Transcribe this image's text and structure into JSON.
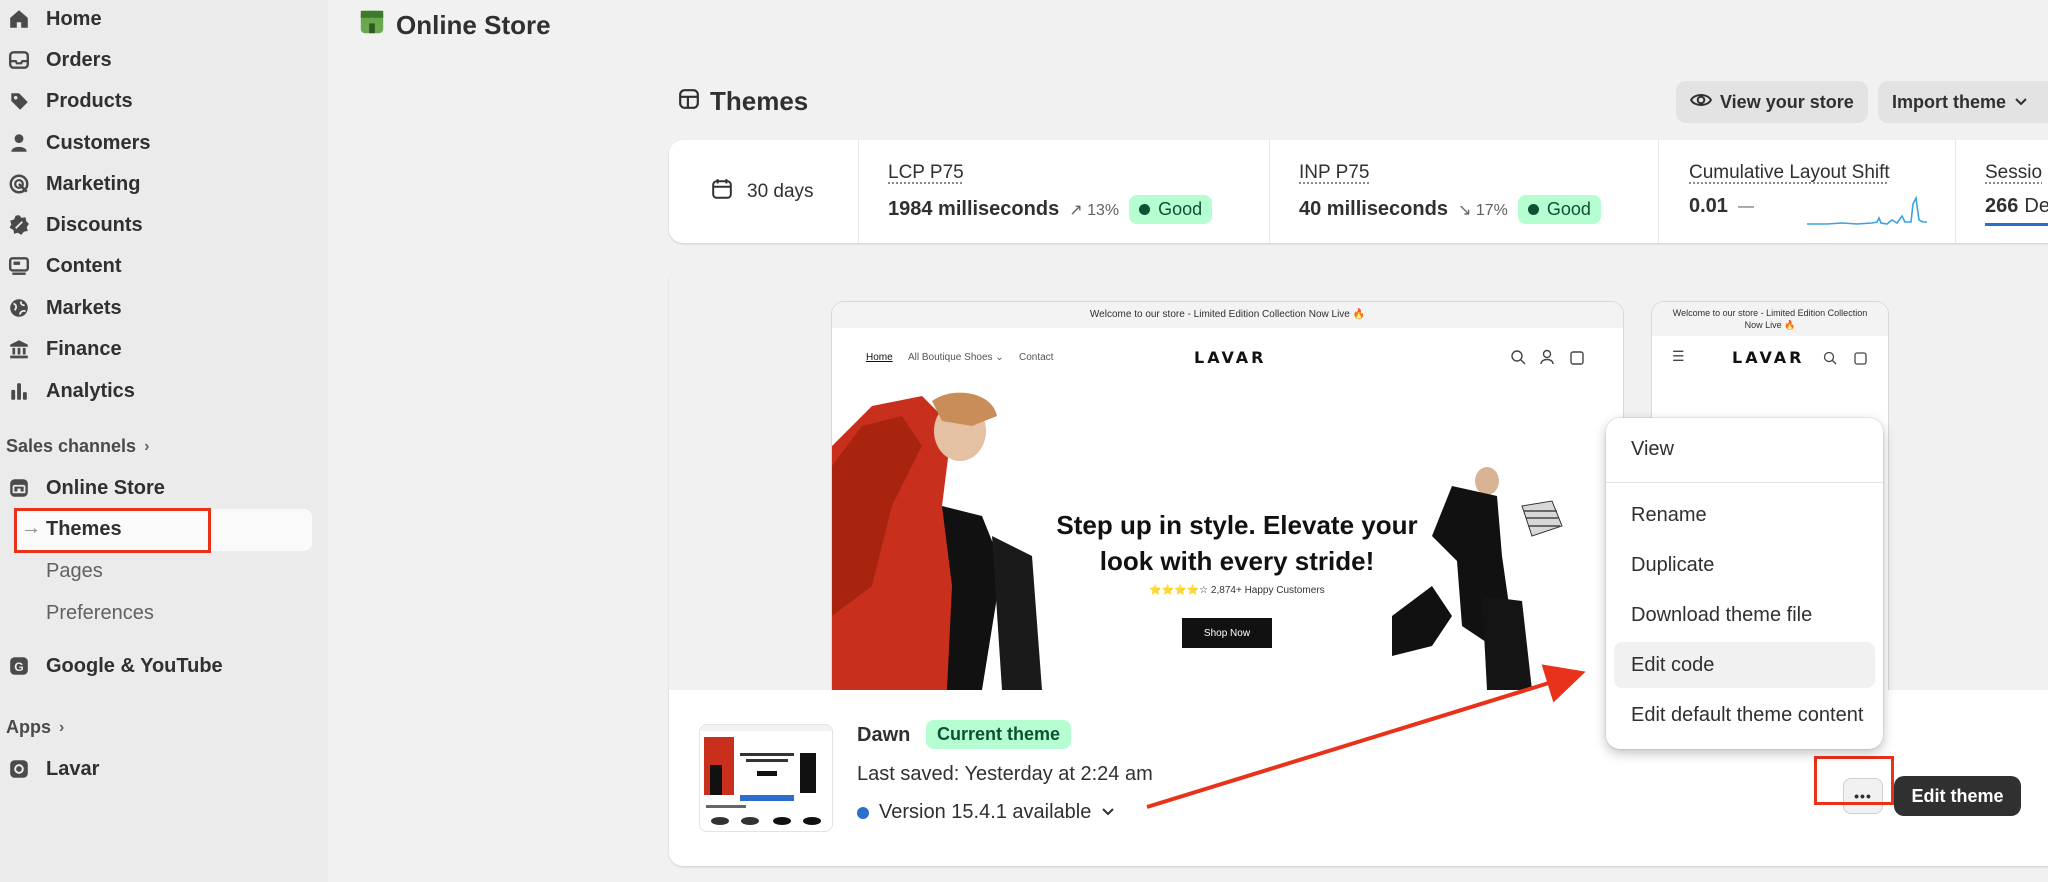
{
  "sidebar": {
    "items": [
      {
        "label": "Home",
        "icon": "home-icon"
      },
      {
        "label": "Orders",
        "icon": "orders-icon"
      },
      {
        "label": "Products",
        "icon": "tag-icon"
      },
      {
        "label": "Customers",
        "icon": "person-icon"
      },
      {
        "label": "Marketing",
        "icon": "target-icon"
      },
      {
        "label": "Discounts",
        "icon": "discount-icon"
      },
      {
        "label": "Content",
        "icon": "content-icon"
      },
      {
        "label": "Markets",
        "icon": "globe-icon"
      },
      {
        "label": "Finance",
        "icon": "bank-icon"
      },
      {
        "label": "Analytics",
        "icon": "bar-chart-icon"
      }
    ],
    "sales_channels_label": "Sales channels",
    "online_store": "Online Store",
    "sub_items": [
      "Themes",
      "Pages",
      "Preferences"
    ],
    "google": "Google & YouTube",
    "apps_label": "Apps",
    "lavar": "Lavar"
  },
  "header": {
    "title": "Online Store",
    "themes_title": "Themes",
    "view_store": "View your store",
    "import_theme": "Import theme"
  },
  "metrics": {
    "range": "30 days",
    "lcp": {
      "title": "LCP P75",
      "value": "1984 milliseconds",
      "change": "13%",
      "status": "Good"
    },
    "inp": {
      "title": "INP P75",
      "value": "40 milliseconds",
      "change": "17%",
      "status": "Good"
    },
    "cls": {
      "title": "Cumulative Layout Shift",
      "value": "0.01",
      "change": "—"
    },
    "sessions": {
      "title": "Sessio",
      "value": "266",
      "suffix": "De"
    }
  },
  "preview": {
    "announcement": "Welcome to our store - Limited Edition Collection Now Live 🔥",
    "mobile_announcement_1": "Welcome to our store - Limited Edition Collection",
    "mobile_announcement_2": "Now Live 🔥",
    "nav": [
      "Home",
      "All Boutique Shoes ⌄",
      "Contact"
    ],
    "logo": "LAVAR",
    "headline_1": "Step up in style. Elevate your",
    "headline_2": "look with every stride!",
    "rating": "⭐⭐⭐⭐☆ 2,874+ Happy Customers",
    "cta": "Shop Now"
  },
  "theme": {
    "name": "Dawn",
    "badge": "Current theme",
    "last_saved": "Last saved: Yesterday at 2:24 am",
    "version": "Version 15.4.1 available",
    "more": "•••",
    "edit_button": "Edit theme"
  },
  "menu": {
    "items": [
      "View",
      "Rename",
      "Duplicate",
      "Download theme file",
      "Edit code",
      "Edit default theme content"
    ]
  },
  "colors": {
    "accent_red": "#e8321a",
    "good_green": "#b4fed2",
    "sparkline": "#3aa3e3"
  }
}
